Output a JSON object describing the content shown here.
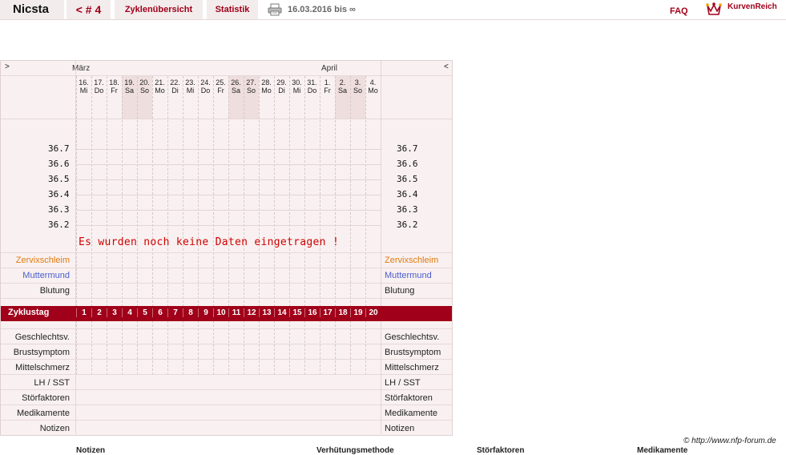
{
  "topbar": {
    "brand": "Nicsta",
    "cycle_nav": "< # 4",
    "tab_overview": "Zyklenübersicht",
    "tab_stats": "Statistik",
    "date_range": "16.03.2016 bis ∞",
    "faq": "FAQ",
    "kurvenreich": "KurvenReich"
  },
  "chart": {
    "nav_prev": ">",
    "nav_next": "<",
    "months": [
      "März",
      "April"
    ],
    "days": [
      {
        "num": "16.",
        "wd": "Mi",
        "weekend": false
      },
      {
        "num": "17.",
        "wd": "Do",
        "weekend": false
      },
      {
        "num": "18.",
        "wd": "Fr",
        "weekend": false
      },
      {
        "num": "19.",
        "wd": "Sa",
        "weekend": true
      },
      {
        "num": "20.",
        "wd": "So",
        "weekend": true
      },
      {
        "num": "21.",
        "wd": "Mo",
        "weekend": false
      },
      {
        "num": "22.",
        "wd": "Di",
        "weekend": false
      },
      {
        "num": "23.",
        "wd": "Mi",
        "weekend": false
      },
      {
        "num": "24.",
        "wd": "Do",
        "weekend": false
      },
      {
        "num": "25.",
        "wd": "Fr",
        "weekend": false
      },
      {
        "num": "26.",
        "wd": "Sa",
        "weekend": true
      },
      {
        "num": "27.",
        "wd": "So",
        "weekend": true
      },
      {
        "num": "28.",
        "wd": "Mo",
        "weekend": false
      },
      {
        "num": "29.",
        "wd": "Di",
        "weekend": false
      },
      {
        "num": "30.",
        "wd": "Mi",
        "weekend": false
      },
      {
        "num": "31.",
        "wd": "Do",
        "weekend": false
      },
      {
        "num": "1.",
        "wd": "Fr",
        "weekend": false
      },
      {
        "num": "2.",
        "wd": "Sa",
        "weekend": true
      },
      {
        "num": "3.",
        "wd": "So",
        "weekend": true
      },
      {
        "num": "4.",
        "wd": "Mo",
        "weekend": false
      }
    ],
    "temps": [
      "36.7",
      "36.6",
      "36.5",
      "36.4",
      "36.3",
      "36.2"
    ],
    "no_data": "Es wurden noch keine Daten eingetragen !",
    "upper_rows": [
      "Zervixschleim",
      "Muttermund",
      "Blutung"
    ],
    "zyklustag_label": "Zyklustag",
    "cycle_days": [
      "1",
      "2",
      "3",
      "4",
      "5",
      "6",
      "7",
      "8",
      "9",
      "10",
      "11",
      "12",
      "13",
      "14",
      "15",
      "16",
      "17",
      "18",
      "19",
      "20"
    ],
    "lower_rows": [
      "Geschlechtsv.",
      "Brustsymptom",
      "Mittelschmerz",
      "LH / SST",
      "Störfaktoren",
      "Medikamente",
      "Notizen"
    ],
    "colors": {
      "accent": "#a00019",
      "zervix": "#e07a10",
      "muttermund": "#4a5ccc"
    }
  },
  "footer": {
    "copyright": "© http://www.nfp-forum.de",
    "columns": [
      "Notizen",
      "Verhütungsmethode",
      "Störfaktoren",
      "Medikamente"
    ]
  }
}
